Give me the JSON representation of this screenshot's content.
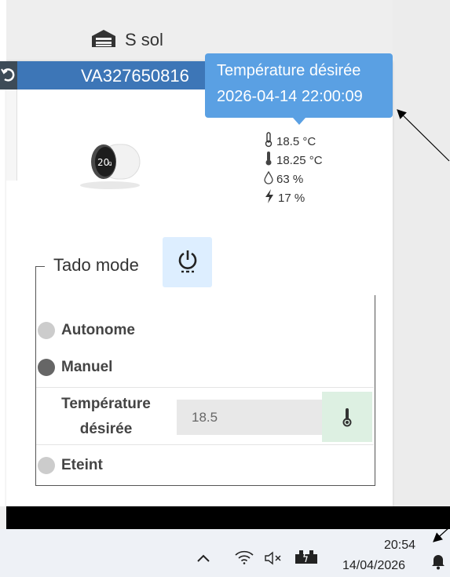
{
  "room": {
    "name": "S sol",
    "icon": "home-garage-icon"
  },
  "device": {
    "id": "VA327650816"
  },
  "tooltip": {
    "title": "Température désirée",
    "timestamp": "2026-04-14 22:00:09"
  },
  "readings": [
    {
      "icon": "thermometer-outline-icon",
      "value": "18.5 °C"
    },
    {
      "icon": "thermometer-filled-icon",
      "value": "18.25 °C"
    },
    {
      "icon": "humidity-drop-icon",
      "value": "63 %"
    },
    {
      "icon": "lightning-icon",
      "value": "17 %"
    }
  ],
  "tado": {
    "legend": "Tado mode",
    "options": [
      {
        "label": "Autonome",
        "selected": false
      },
      {
        "label": "Manuel",
        "selected": true
      },
      {
        "label": "Eteint",
        "selected": false
      }
    ],
    "temperature_label_line1": "Température",
    "temperature_label_line2": "désirée",
    "temperature_value": "18.5"
  },
  "taskbar": {
    "time": "20:54",
    "date": "14/04/2026"
  },
  "colors": {
    "topbar": "#3d76b7",
    "tooltip": "#5aa0e3",
    "power_button_bg": "#ddeeff",
    "temp_button_bg": "#ddf0e2",
    "radio_selected": "#666666",
    "radio_unselected": "#cccccc"
  }
}
